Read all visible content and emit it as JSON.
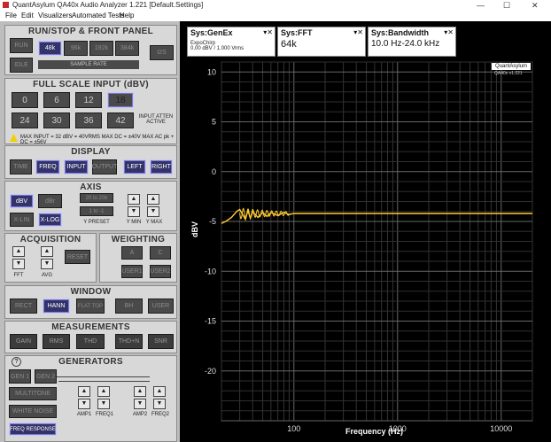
{
  "window": {
    "title": "QuantAsylum QA40x Audio Analyzer 1.221 [Default.Settings]",
    "minimize": "—",
    "maximize": "☐",
    "close": "✕"
  },
  "menu": [
    "File",
    "Edit",
    "Visualizers",
    "Automated Tests",
    "Help"
  ],
  "runstop": {
    "title": "RUN/STOP & FRONT PANEL",
    "run": "RUN",
    "idle": "IDLE",
    "rates": [
      "48k",
      "96k",
      "192k",
      "384k"
    ],
    "rate_label": "SAMPLE RATE",
    "i2s": "I2S"
  },
  "fullscale": {
    "title": "FULL SCALE INPUT (dBV)",
    "values": [
      "0",
      "6",
      "12",
      "18",
      "24",
      "30",
      "36",
      "42"
    ],
    "atten_label": "INPUT ATTEN ACTIVE",
    "warning": "MAX INPUT = 32 dBV = 40VRMS    MAX DC = ±40V    MAX AC pk + DC = ±56V"
  },
  "display": {
    "title": "DISPLAY",
    "buttons": [
      "TIME",
      "FREQ",
      "INPUT",
      "OUTPUT",
      "LEFT",
      "RIGHT"
    ]
  },
  "axis": {
    "title": "AXIS",
    "dbv": "dBV",
    "dbr": "dBr",
    "xlin": "X-LIN",
    "xlog": "X-LOG",
    "preset1": "20 to 20k",
    "preset2": "1 to -1",
    "preset_label": "Y PRESET",
    "ymin": "Y MIN",
    "ymax": "Y MAX"
  },
  "acquisition": {
    "title": "ACQUISITION",
    "reset": "RESET",
    "fft": "FFT",
    "avg": "AVG"
  },
  "weighting": {
    "title": "WEIGHTING",
    "a": "A",
    "c": "C",
    "user1": "USER1",
    "user2": "USER2"
  },
  "window_panel": {
    "title": "WINDOW",
    "buttons": [
      "RECT",
      "HANN",
      "FLAT TOP",
      "BH",
      "USER"
    ]
  },
  "measurements": {
    "title": "MEASUREMENTS",
    "buttons": [
      "GAIN",
      "RMS",
      "THD",
      "THD+N",
      "SNR"
    ]
  },
  "generators": {
    "title": "GENERATORS",
    "gen1": "GEN 1",
    "gen2": "GEN 2",
    "multitone": "MULTITONE",
    "whitenoise": "WHITE NOISE",
    "freqresp": "FREQ RESPONSE",
    "amp1": "AMP1",
    "freq1": "FREQ1",
    "amp2": "AMP2",
    "freq2": "FREQ2"
  },
  "headers": [
    {
      "name": "Sys:GenEx",
      "value": "",
      "sub": "ExpoChirp\n0.00 dBV / 1.000 Vrms"
    },
    {
      "name": "Sys:FFT",
      "value": "64k",
      "sub": ""
    },
    {
      "name": "Sys:Bandwidth",
      "value": "10.0 Hz-24.0 kHz",
      "sub": ""
    }
  ],
  "chart_data": {
    "type": "line",
    "xlabel": "Frequency (Hz)",
    "ylabel": "dBV",
    "xscale": "log",
    "xlim": [
      20,
      20000
    ],
    "ylim": [
      -25,
      11
    ],
    "yticks": [
      10,
      5,
      0,
      -5,
      -10,
      -15,
      -20
    ],
    "xticks": [
      100,
      1000,
      10000
    ],
    "xtick_labels": [
      "100",
      "1000",
      "10000"
    ],
    "grid": true,
    "logo_text": "QuantAsylum",
    "version": "QA40x v1.221",
    "series": [
      {
        "color": "#ffcc33",
        "x": [
          20,
          22,
          25,
          28,
          30,
          32,
          34,
          36,
          38,
          40,
          45,
          50,
          55,
          60,
          70,
          80,
          90,
          100,
          110,
          120,
          150,
          200,
          300,
          500,
          1000,
          2000,
          5000,
          10000,
          20000
        ],
        "y": [
          -5.2,
          -5.0,
          -4.6,
          -4.0,
          -3.8,
          -4.3,
          -4.8,
          -3.9,
          -4.7,
          -4.0,
          -4.6,
          -4.1,
          -4.5,
          -4.1,
          -4.4,
          -4.1,
          -4.3,
          -4.2,
          -4.2,
          -4.2,
          -4.2,
          -4.2,
          -4.2,
          -4.2,
          -4.2,
          -4.2,
          -4.2,
          -4.2,
          -4.2
        ]
      }
    ]
  },
  "colors": {
    "plot_bg": "#000000",
    "grid": "#555555",
    "trace": "#ffcc33",
    "active_button": "#33336a"
  }
}
